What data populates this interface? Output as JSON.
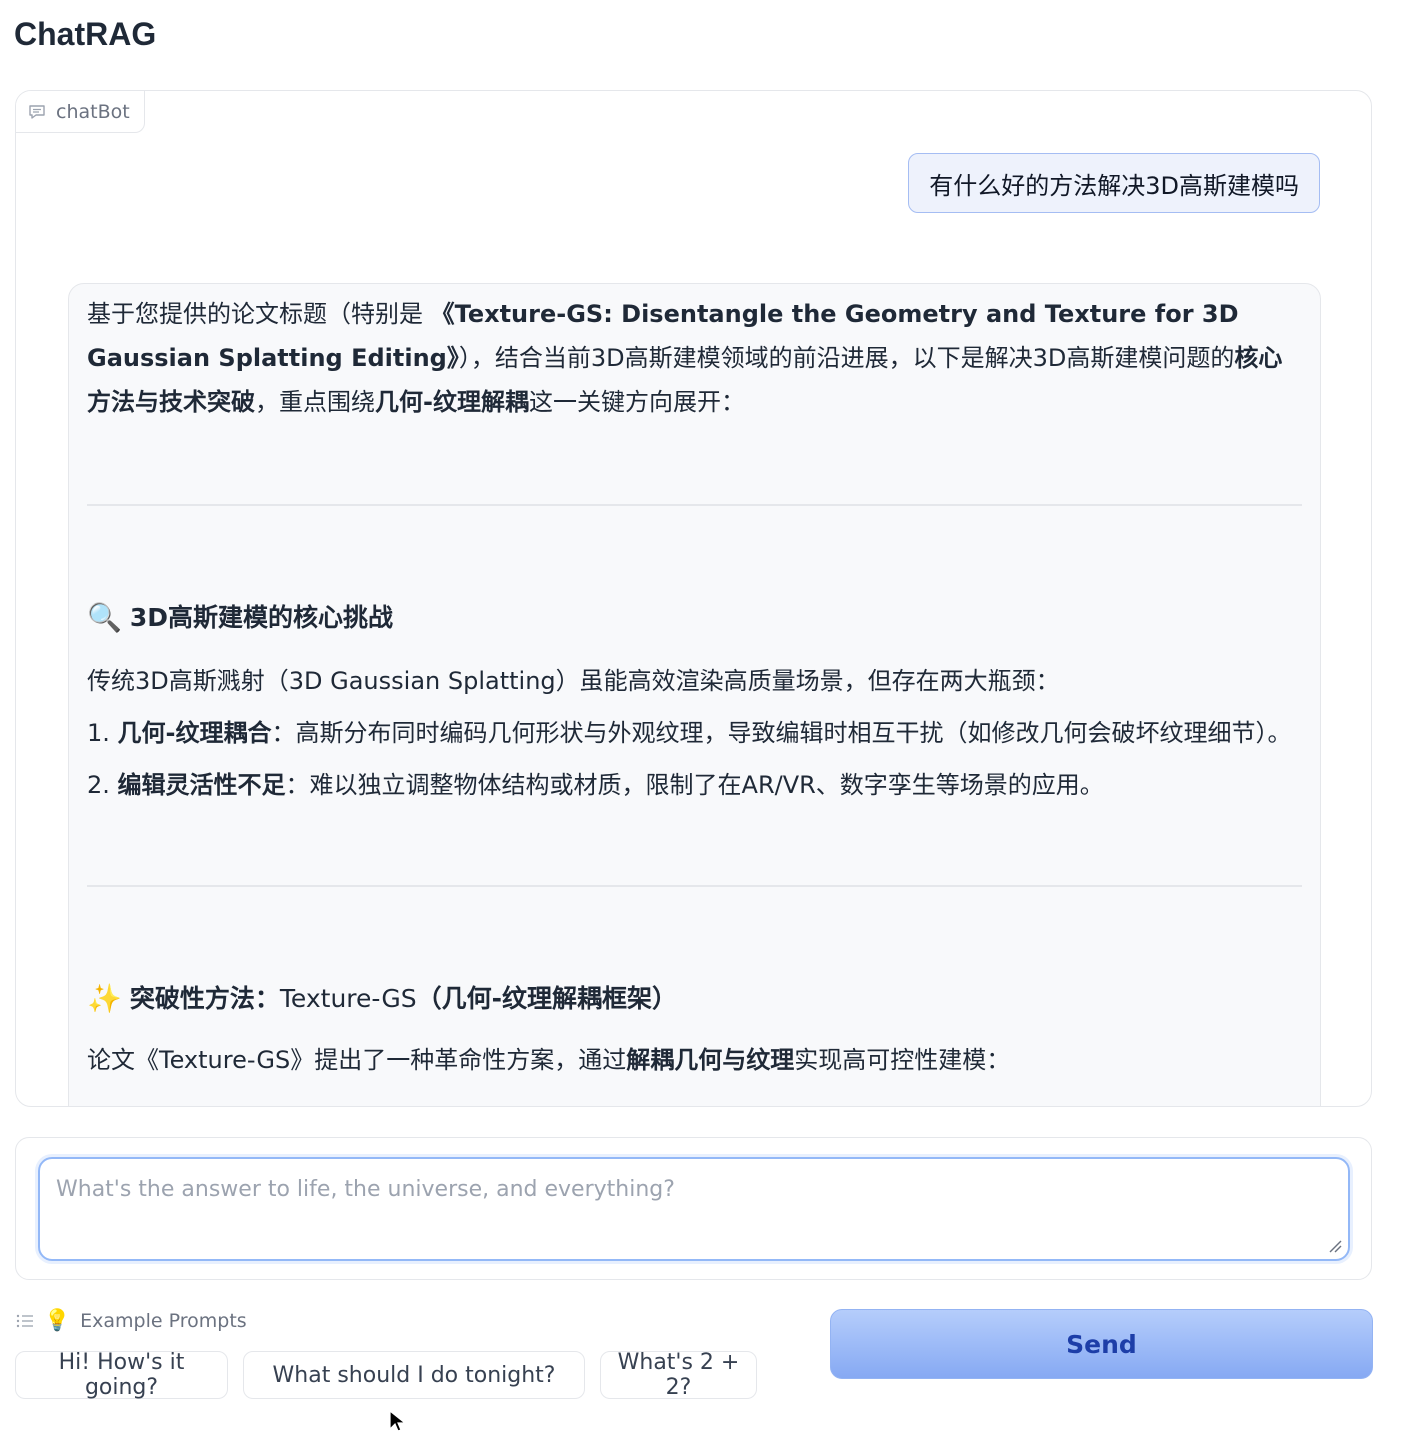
{
  "app": {
    "title": "ChatRAG"
  },
  "chatbot": {
    "label": "chatBot",
    "user_message": "有什么好的方法解决3D高斯建模吗",
    "bot": {
      "intro": {
        "p1": "基于您提供的论文标题（特别是 ",
        "b1": "《Texture-GS: Disentangle the Geometry and Texture for 3D Gaussian Splatting Editing》",
        "p2": "），结合当前3D高斯建模领域的前沿进展，以下是解决3D高斯建模问题的",
        "b2": "核心方法与技术突破",
        "p3": "，重点围绕",
        "b3": "几何-纹理解耦",
        "p4": "这一关键方向展开："
      },
      "section1": {
        "icon": "🔍",
        "title": "3D高斯建模的核心挑战",
        "para": "传统3D高斯溅射（3D Gaussian Splatting）虽能高效渲染高质量场景，但存在两大瓶颈：",
        "item1": {
          "num": "1. ",
          "bold": "几何-纹理耦合",
          "text": "：高斯分布同时编码几何形状与外观纹理，导致编辑时相互干扰（如修改几何会破坏纹理细节）。"
        },
        "item2": {
          "num": "2. ",
          "bold": "编辑灵活性不足",
          "text": "：难以独立调整物体结构或材质，限制了在AR/VR、数字孪生等场景的应用。"
        }
      },
      "section2": {
        "icon": "✨",
        "title_bold1": "突破性方法：",
        "title_plain": "Texture-GS",
        "title_bold2": "（几何-纹理解耦框架）",
        "para_p1": "论文《Texture-GS》提出了一种革命性方案，通过",
        "para_b1": "解耦几何与纹理",
        "para_p2": "实现高可控性建模："
      }
    }
  },
  "input": {
    "placeholder": "What's the answer to life, the universe, and everything?",
    "value": ""
  },
  "examples": {
    "header": "Example Prompts",
    "prompts": [
      "Hi! How's it going?",
      "What should I do tonight?",
      "What's 2 + 2?"
    ]
  },
  "send_label": "Send"
}
